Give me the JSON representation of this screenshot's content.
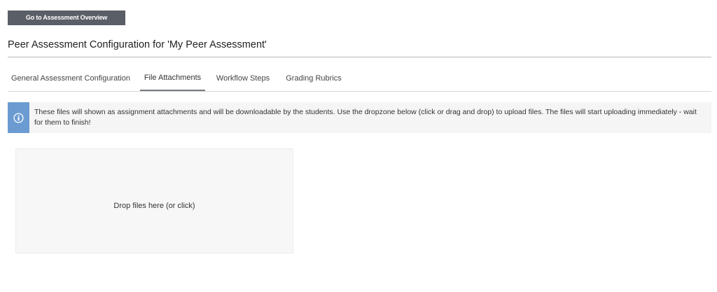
{
  "top": {
    "overview_button_label": "Go to Assessment Overview"
  },
  "page": {
    "title": "Peer Assessment Configuration for 'My Peer Assessment'"
  },
  "tabs": [
    {
      "label": "General Assessment Configuration",
      "active": false
    },
    {
      "label": "File Attachments",
      "active": true
    },
    {
      "label": "Workflow Steps",
      "active": false
    },
    {
      "label": "Grading Rubrics",
      "active": false
    }
  ],
  "info": {
    "icon": "info-circle-icon",
    "text": "These files will shown as assignment attachments and will be downloadable by the students. Use the dropzone below (click or drag and drop) to upload files. The files will start uploading immediately - wait for them to finish!",
    "accent_color": "#6b9bd1"
  },
  "dropzone": {
    "label": "Drop files here (or click)"
  }
}
